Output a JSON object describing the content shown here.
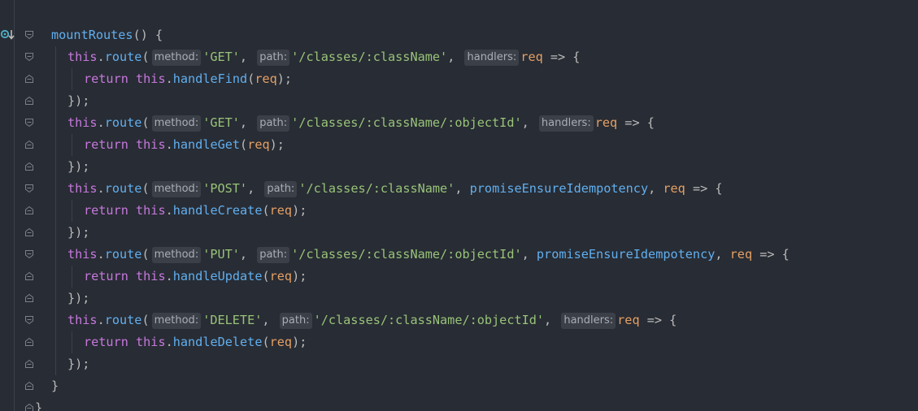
{
  "code": {
    "method_name": "mountRoutes",
    "lines": [
      {
        "indent": 0,
        "tokens": [
          [
            "def",
            "mountRoutes"
          ],
          [
            "punc",
            "() {"
          ]
        ]
      },
      {
        "indent": 1,
        "tokens": [
          [
            "kw-this",
            "this"
          ],
          [
            "punc",
            "."
          ],
          [
            "mth",
            "route"
          ],
          [
            "punc",
            "("
          ],
          [
            "hint",
            "method:"
          ],
          [
            "str",
            "'GET'"
          ],
          [
            "punc",
            ", "
          ],
          [
            "hint",
            "path:"
          ],
          [
            "str",
            "'/classes/:className'"
          ],
          [
            "punc",
            ", "
          ],
          [
            "hint",
            "handlers:"
          ],
          [
            "param",
            "req"
          ],
          [
            "punc",
            " => {"
          ]
        ]
      },
      {
        "indent": 2,
        "tokens": [
          [
            "kw",
            "return "
          ],
          [
            "kw-this",
            "this"
          ],
          [
            "punc",
            "."
          ],
          [
            "mth",
            "handleFind"
          ],
          [
            "punc",
            "("
          ],
          [
            "param",
            "req"
          ],
          [
            "punc",
            ");"
          ]
        ]
      },
      {
        "indent": 1,
        "tokens": [
          [
            "punc",
            "});"
          ]
        ]
      },
      {
        "indent": 1,
        "tokens": [
          [
            "kw-this",
            "this"
          ],
          [
            "punc",
            "."
          ],
          [
            "mth",
            "route"
          ],
          [
            "punc",
            "("
          ],
          [
            "hint",
            "method:"
          ],
          [
            "str",
            "'GET'"
          ],
          [
            "punc",
            ", "
          ],
          [
            "hint",
            "path:"
          ],
          [
            "str",
            "'/classes/:className/:objectId'"
          ],
          [
            "punc",
            ", "
          ],
          [
            "hint",
            "handlers:"
          ],
          [
            "param",
            "req"
          ],
          [
            "punc",
            " => {"
          ]
        ]
      },
      {
        "indent": 2,
        "tokens": [
          [
            "kw",
            "return "
          ],
          [
            "kw-this",
            "this"
          ],
          [
            "punc",
            "."
          ],
          [
            "mth",
            "handleGet"
          ],
          [
            "punc",
            "("
          ],
          [
            "param",
            "req"
          ],
          [
            "punc",
            ");"
          ]
        ]
      },
      {
        "indent": 1,
        "tokens": [
          [
            "punc",
            "});"
          ]
        ]
      },
      {
        "indent": 1,
        "tokens": [
          [
            "kw-this",
            "this"
          ],
          [
            "punc",
            "."
          ],
          [
            "mth",
            "route"
          ],
          [
            "punc",
            "("
          ],
          [
            "hint",
            "method:"
          ],
          [
            "str",
            "'POST'"
          ],
          [
            "punc",
            ", "
          ],
          [
            "hint",
            "path:"
          ],
          [
            "str",
            "'/classes/:className'"
          ],
          [
            "punc",
            ", "
          ],
          [
            "fn",
            "promiseEnsureIdempotency"
          ],
          [
            "punc",
            ", "
          ],
          [
            "param",
            "req"
          ],
          [
            "punc",
            " => {"
          ]
        ]
      },
      {
        "indent": 2,
        "tokens": [
          [
            "kw",
            "return "
          ],
          [
            "kw-this",
            "this"
          ],
          [
            "punc",
            "."
          ],
          [
            "mth",
            "handleCreate"
          ],
          [
            "punc",
            "("
          ],
          [
            "param",
            "req"
          ],
          [
            "punc",
            ");"
          ]
        ]
      },
      {
        "indent": 1,
        "tokens": [
          [
            "punc",
            "});"
          ]
        ]
      },
      {
        "indent": 1,
        "tokens": [
          [
            "kw-this",
            "this"
          ],
          [
            "punc",
            "."
          ],
          [
            "mth",
            "route"
          ],
          [
            "punc",
            "("
          ],
          [
            "hint",
            "method:"
          ],
          [
            "str",
            "'PUT'"
          ],
          [
            "punc",
            ", "
          ],
          [
            "hint",
            "path:"
          ],
          [
            "str",
            "'/classes/:className/:objectId'"
          ],
          [
            "punc",
            ", "
          ],
          [
            "fn",
            "promiseEnsureIdempotency"
          ],
          [
            "punc",
            ", "
          ],
          [
            "param",
            "req"
          ],
          [
            "punc",
            " => {"
          ]
        ]
      },
      {
        "indent": 2,
        "tokens": [
          [
            "kw",
            "return "
          ],
          [
            "kw-this",
            "this"
          ],
          [
            "punc",
            "."
          ],
          [
            "mth",
            "handleUpdate"
          ],
          [
            "punc",
            "("
          ],
          [
            "param",
            "req"
          ],
          [
            "punc",
            ");"
          ]
        ]
      },
      {
        "indent": 1,
        "tokens": [
          [
            "punc",
            "});"
          ]
        ]
      },
      {
        "indent": 1,
        "tokens": [
          [
            "kw-this",
            "this"
          ],
          [
            "punc",
            "."
          ],
          [
            "mth",
            "route"
          ],
          [
            "punc",
            "("
          ],
          [
            "hint",
            "method:"
          ],
          [
            "str",
            "'DELETE'"
          ],
          [
            "punc",
            ", "
          ],
          [
            "hint",
            "path:"
          ],
          [
            "str",
            "'/classes/:className/:objectId'"
          ],
          [
            "punc",
            ", "
          ],
          [
            "hint",
            "handlers:"
          ],
          [
            "param",
            "req"
          ],
          [
            "punc",
            " => {"
          ]
        ]
      },
      {
        "indent": 2,
        "tokens": [
          [
            "kw",
            "return "
          ],
          [
            "kw-this",
            "this"
          ],
          [
            "punc",
            "."
          ],
          [
            "mth",
            "handleDelete"
          ],
          [
            "punc",
            "("
          ],
          [
            "param",
            "req"
          ],
          [
            "punc",
            ");"
          ]
        ]
      },
      {
        "indent": 1,
        "tokens": [
          [
            "punc",
            "});"
          ]
        ]
      },
      {
        "indent": 0,
        "tokens": [
          [
            "punc",
            "}"
          ]
        ]
      },
      {
        "indent": -1,
        "tokens": [
          [
            "punc",
            "}"
          ]
        ]
      }
    ]
  },
  "gutter": {
    "override_icon": "override-method-icon",
    "fold_markers": [
      "fold-open",
      "fold-open",
      "fold-end",
      "fold-end",
      "fold-open",
      "fold-end",
      "fold-end",
      "fold-open",
      "fold-end",
      "fold-end",
      "fold-open",
      "fold-end",
      "fold-end",
      "fold-open",
      "fold-end",
      "fold-end",
      "fold-end",
      "fold-end"
    ]
  },
  "colors": {
    "background": "#282c34",
    "keyword": "#c678dd",
    "function": "#61afef",
    "string": "#98c379",
    "parameter": "#e5a064",
    "hint_bg": "#3b3f47"
  }
}
